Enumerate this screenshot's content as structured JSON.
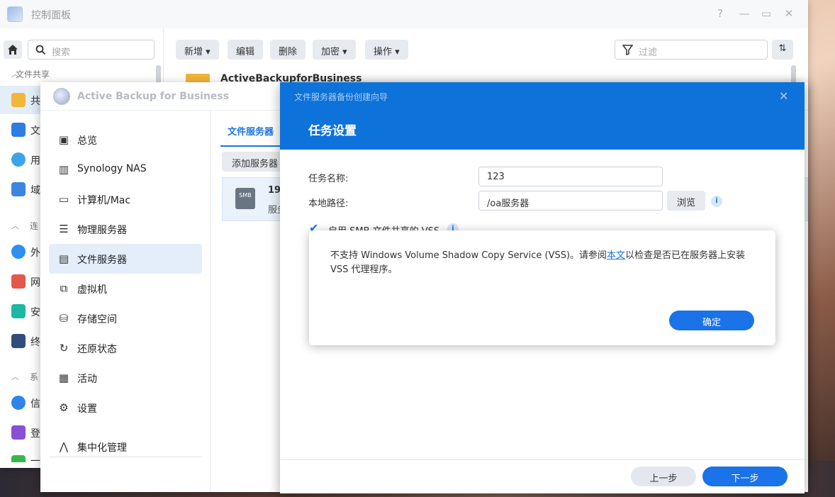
{
  "control_panel": {
    "title": "控制面板",
    "window_controls": [
      "?",
      "—",
      "▭",
      "✕"
    ],
    "search": {
      "placeholder": "搜索"
    },
    "sidebar": {
      "sections": [
        {
          "label": "文件共享",
          "collapsed": false
        },
        {
          "label": "连",
          "collapsed": false
        },
        {
          "label": "系",
          "collapsed": false
        }
      ],
      "items": [
        {
          "label": "共",
          "icon": "share-folder-icon",
          "selected": true
        },
        {
          "label": "文",
          "icon": "file-services-icon"
        },
        {
          "label": "用",
          "icon": "users-icon"
        },
        {
          "label": "域",
          "icon": "domain-icon"
        },
        {
          "label": "外",
          "icon": "external-access-icon"
        },
        {
          "label": "网",
          "icon": "network-icon"
        },
        {
          "label": "安",
          "icon": "security-icon"
        },
        {
          "label": "终",
          "icon": "terminal-icon"
        },
        {
          "label": "信",
          "icon": "info-icon"
        },
        {
          "label": "登",
          "icon": "login-portal-icon"
        },
        {
          "label": "一",
          "icon": "more-icon"
        }
      ]
    },
    "toolbar": {
      "new_label": "新增 ▾",
      "edit_label": "编辑",
      "delete_label": "删除",
      "encrypt_label": "加密 ▾",
      "action_label": "操作 ▾",
      "filter_placeholder": "过滤"
    },
    "list": [
      {
        "name": "ActiveBackupforBusiness"
      }
    ]
  },
  "abb": {
    "title": "Active Backup for Business",
    "nav": [
      {
        "label": "总览",
        "icon": "overview-icon"
      },
      {
        "label": "Synology NAS",
        "icon": "nas-icon"
      },
      {
        "label": "计算机/Mac",
        "icon": "computer-icon"
      },
      {
        "label": "物理服务器",
        "icon": "physical-server-icon"
      },
      {
        "label": "文件服务器",
        "icon": "file-server-icon",
        "selected": true
      },
      {
        "label": "虚拟机",
        "icon": "vm-icon"
      },
      {
        "label": "存储空间",
        "icon": "storage-icon"
      },
      {
        "label": "还原状态",
        "icon": "restore-icon"
      },
      {
        "label": "活动",
        "icon": "activity-icon"
      },
      {
        "label": "设置",
        "icon": "gear-icon"
      },
      {
        "label": "集中化管理",
        "icon": "central-management-icon"
      }
    ],
    "tab": "文件服务器",
    "add_server_label": "添加服务器",
    "server_row": {
      "badge": "SMB",
      "name": "19",
      "sub": "服务"
    }
  },
  "wizard": {
    "window_title": "文件服务器备份创建向导",
    "step_title": "任务设置",
    "fields": {
      "task_name_label": "任务名称:",
      "task_name_value": "123",
      "local_path_label": "本地路径:",
      "local_path_value": "/oa服务器",
      "browse_label": "浏览"
    },
    "vss_checkbox": {
      "label": "启用 SMB 文件共享的 VSS",
      "checked": true
    },
    "prev_label": "上一步",
    "next_label": "下一步"
  },
  "alert": {
    "message_before": "不支持 Windows Volume Shadow Copy Service (VSS)。请参阅",
    "link_text": "本文",
    "message_after": "以检查是否已在服务器上安装 VSS 代理程序。",
    "ok_label": "确定"
  },
  "colors": {
    "accent": "#1a73e8",
    "wizard_header": "#0d72d9",
    "selected_nav": "#e4eefa"
  }
}
